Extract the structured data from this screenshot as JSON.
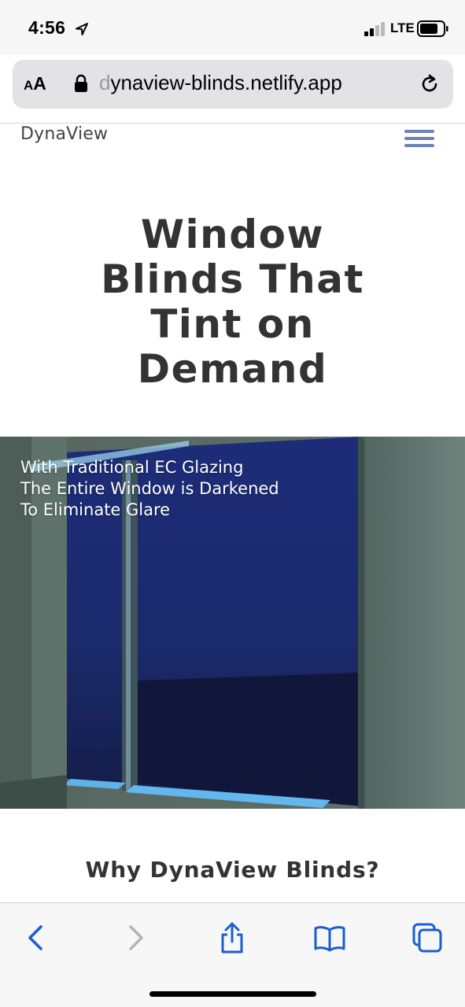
{
  "status_bar": {
    "time": "4:56",
    "network": "LTE",
    "icons": [
      "location-arrow-icon",
      "signal-icon",
      "battery-icon"
    ]
  },
  "browser": {
    "text_size_small": "A",
    "text_size_big": "A",
    "url_faded": "d",
    "url": "ynaview-blinds.netlify.app",
    "icons": [
      "lock-icon",
      "reload-icon"
    ]
  },
  "site": {
    "brand": "DynaView",
    "menu_icon": "hamburger-menu-icon",
    "accent_color": "#6b83b8",
    "hero": {
      "title_lines": [
        "Window",
        "Blinds That",
        "Tint on",
        "Demand"
      ]
    },
    "image_caption_lines": [
      "With Traditional EC Glazing",
      "The Entire Window is Darkened",
      "To Eliminate Glare"
    ],
    "section_heading": "Why DynaView Blinds?"
  },
  "toolbar": {
    "color": "#1a5fd1",
    "buttons": [
      "back-icon",
      "forward-icon",
      "share-icon",
      "bookmarks-icon",
      "tabs-icon"
    ]
  }
}
